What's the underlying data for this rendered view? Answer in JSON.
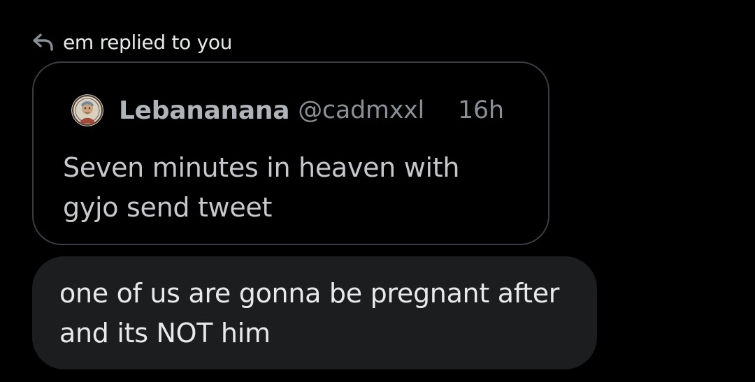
{
  "notification": {
    "icon": "reply-arrow-icon",
    "label": "em replied to you"
  },
  "quoted_tweet": {
    "avatar_icon": "avatar-portrait",
    "display_name": "Lebananana",
    "handle": "@cadmxxl",
    "time": "16h",
    "text": "Seven minutes in heaven with\ngyjo send tweet"
  },
  "reply": {
    "text": "one of us are gonna be pregnant after\nand its NOT him"
  },
  "colors": {
    "background": "#000000",
    "bubble": "#1c1d1f",
    "card_border": "#3a3d41",
    "primary_text": "#e7e9ea",
    "secondary_text": "#8b8f94"
  }
}
